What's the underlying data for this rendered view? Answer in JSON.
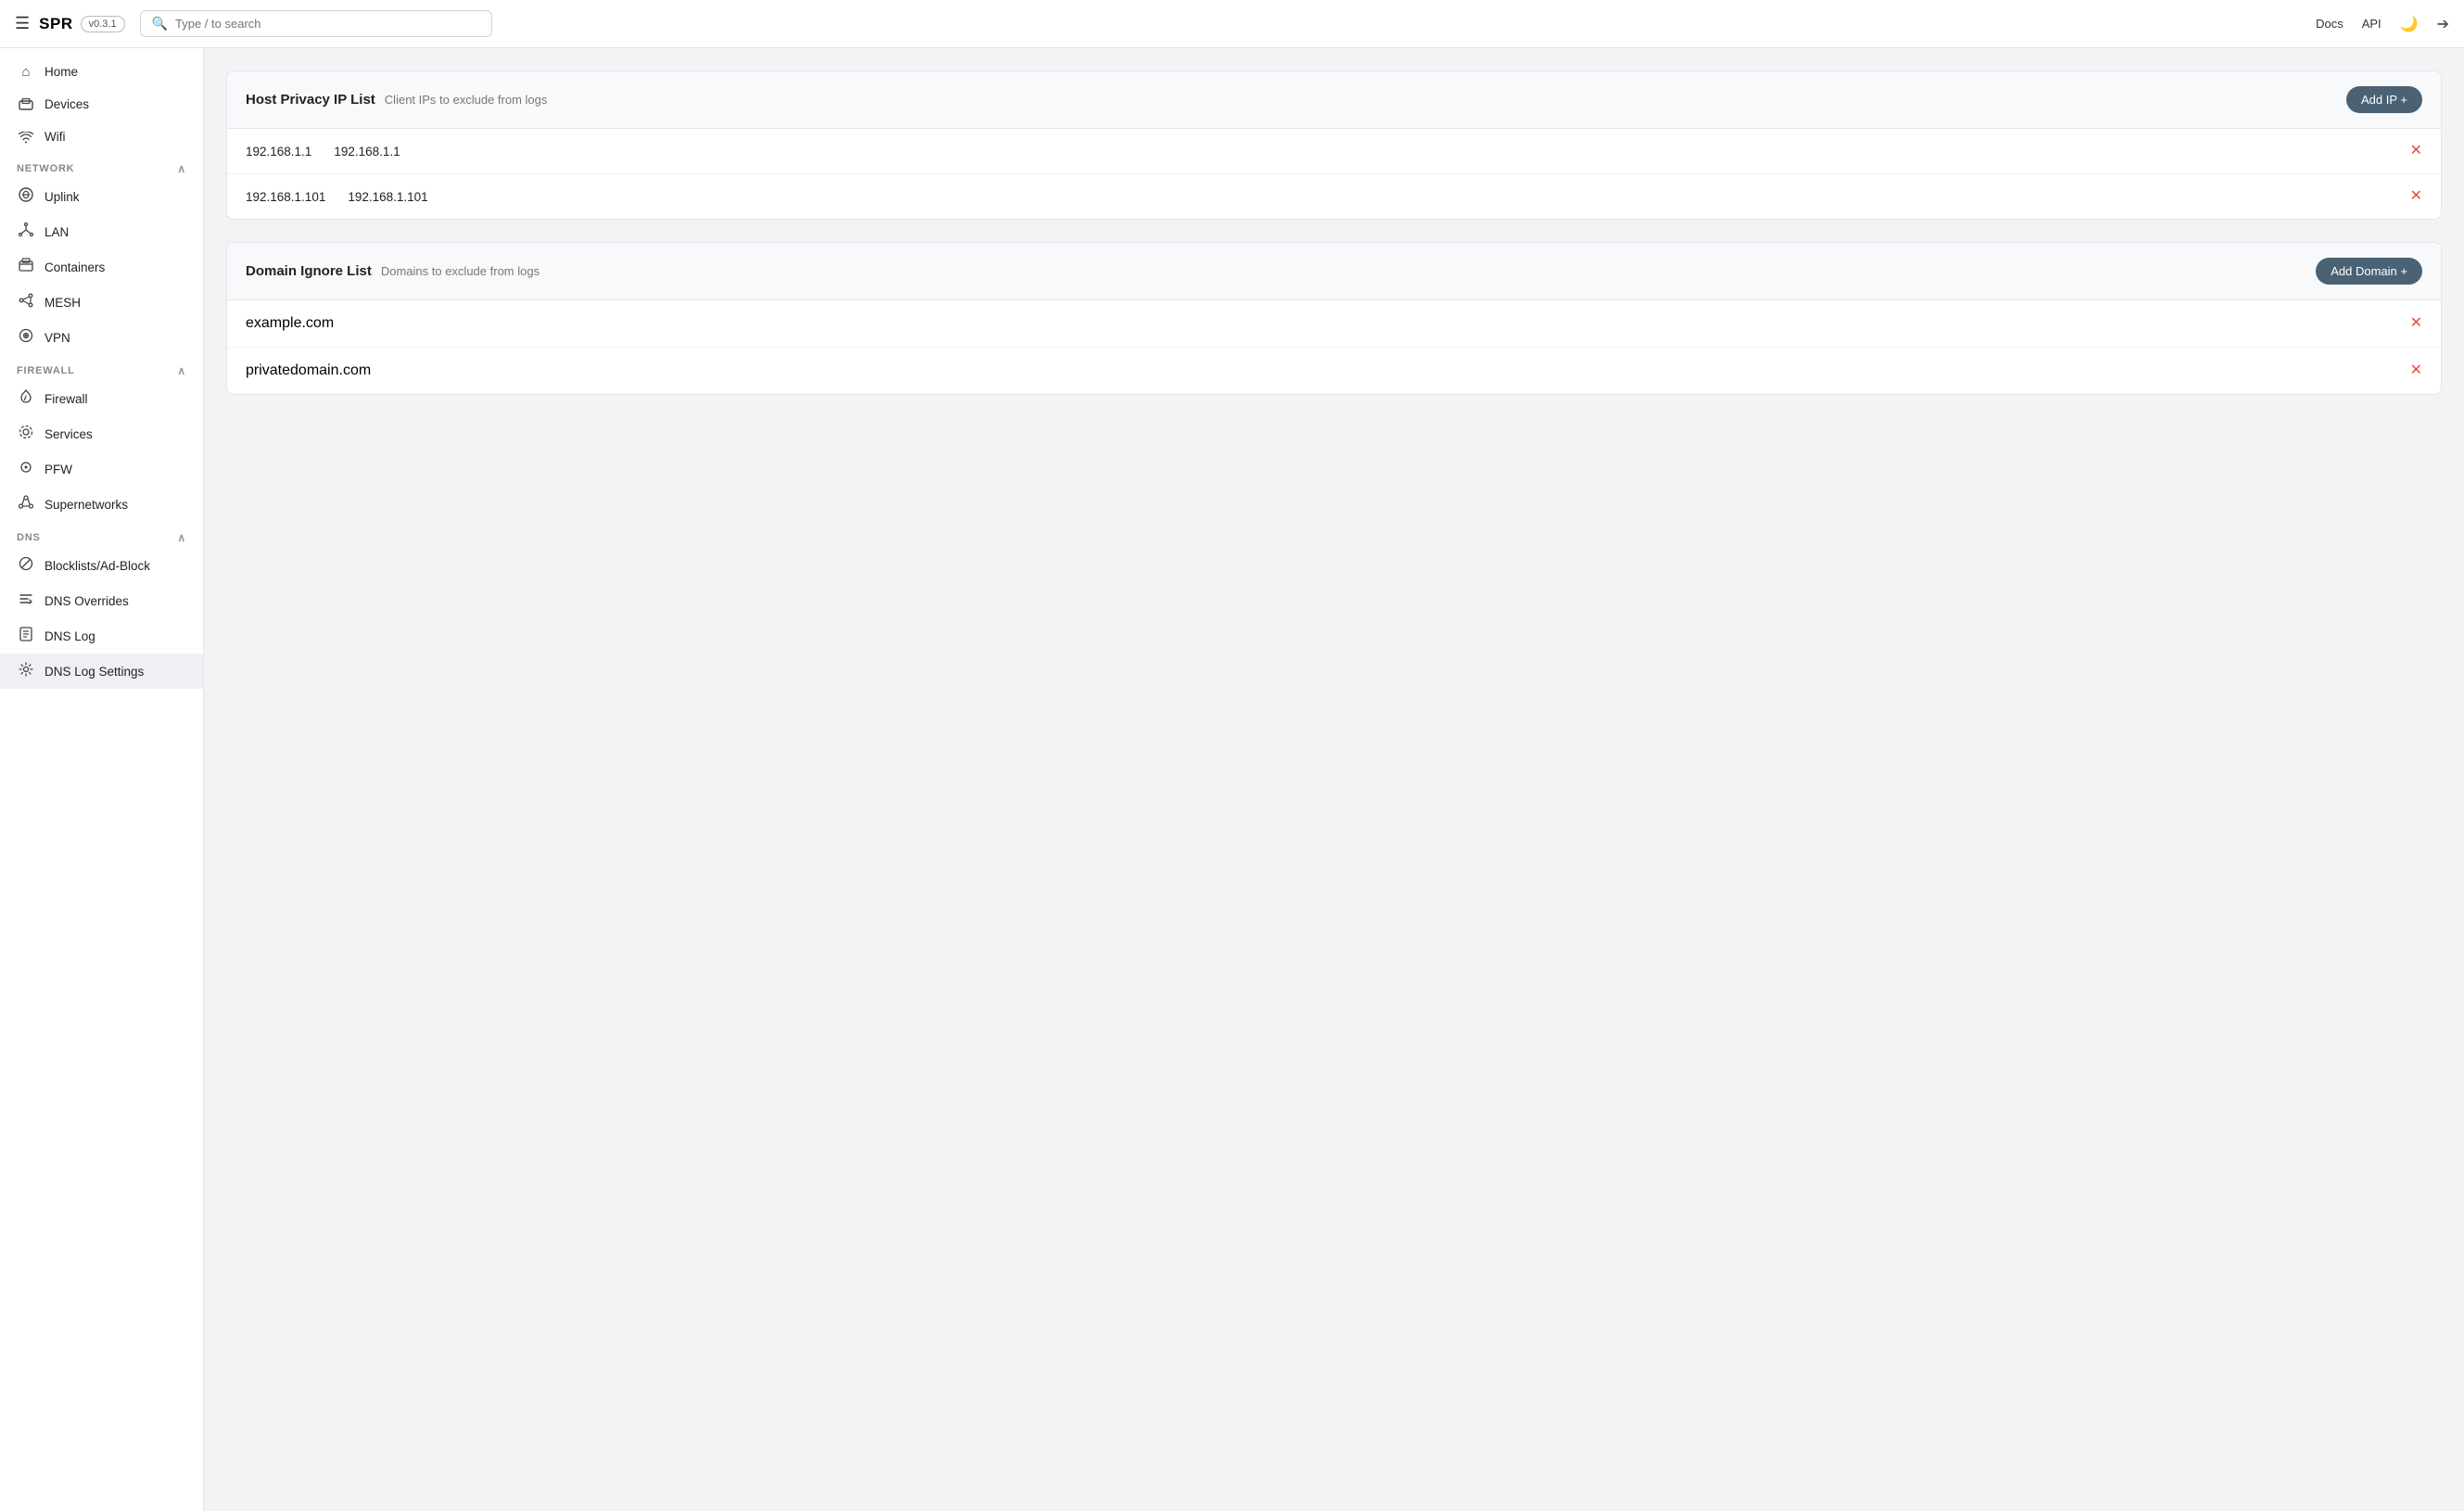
{
  "topbar": {
    "menu_icon": "☰",
    "logo": "SPR",
    "version": "v0.3.1",
    "search_placeholder": "Type / to search",
    "docs_label": "Docs",
    "api_label": "API",
    "moon_icon": "🌙",
    "logout_icon": "⬚"
  },
  "sidebar": {
    "items": [
      {
        "id": "home",
        "label": "Home",
        "icon": "⌂"
      },
      {
        "id": "devices",
        "label": "Devices",
        "icon": "▭"
      },
      {
        "id": "wifi",
        "label": "Wifi",
        "icon": "⌔"
      }
    ],
    "sections": [
      {
        "label": "NETWORK",
        "collapsed": false,
        "items": [
          {
            "id": "uplink",
            "label": "Uplink",
            "icon": "⊕"
          },
          {
            "id": "lan",
            "label": "LAN",
            "icon": "⌬"
          },
          {
            "id": "containers",
            "label": "Containers",
            "icon": "⬡"
          },
          {
            "id": "mesh",
            "label": "MESH",
            "icon": "⌾"
          },
          {
            "id": "vpn",
            "label": "VPN",
            "icon": "⍉"
          }
        ]
      },
      {
        "label": "FIREWALL",
        "collapsed": false,
        "items": [
          {
            "id": "firewall",
            "label": "Firewall",
            "icon": "🔥"
          },
          {
            "id": "services",
            "label": "Services",
            "icon": "⌾"
          },
          {
            "id": "pfw",
            "label": "PFW",
            "icon": "◎"
          },
          {
            "id": "supernetworks",
            "label": "Supernetworks",
            "icon": "⌬"
          }
        ]
      },
      {
        "label": "DNS",
        "collapsed": false,
        "items": [
          {
            "id": "blocklists",
            "label": "Blocklists/Ad-Block",
            "icon": "⊘"
          },
          {
            "id": "dns-overrides",
            "label": "DNS Overrides",
            "icon": "⌁"
          },
          {
            "id": "dns-log",
            "label": "DNS Log",
            "icon": "≡"
          },
          {
            "id": "dns-log-settings",
            "label": "DNS Log Settings",
            "icon": "⚙",
            "active": true
          }
        ]
      }
    ]
  },
  "main": {
    "host_privacy": {
      "title": "Host Privacy IP List",
      "subtitle": "Client IPs to exclude from logs",
      "add_button": "Add IP +",
      "rows": [
        {
          "col1": "192.168.1.1",
          "col2": "192.168.1.1"
        },
        {
          "col1": "192.168.1.101",
          "col2": "192.168.1.101"
        }
      ]
    },
    "domain_ignore": {
      "title": "Domain Ignore List",
      "subtitle": "Domains to exclude from logs",
      "add_button": "Add Domain +",
      "rows": [
        {
          "value": "example.com"
        },
        {
          "value": "privatedomain.com"
        }
      ]
    }
  }
}
